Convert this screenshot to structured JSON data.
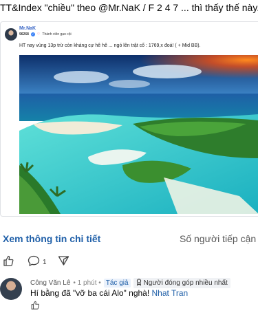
{
  "post": {
    "header_text": "TT&Index \"chiều\" theo @Mr.NaK / F 2 4 7 ... thì thấy thế này.",
    "author": "Mr.NaK",
    "user_id": "96268",
    "badge": "Thành viên gạo cội",
    "body": "HT nay vùng 13p trừ còn kháng cự hê hê ... ngó lên trật cổ : 1769,x đoá! ( + Mid BB).",
    "image_alt": "tropical island lagoon",
    "more_link": "Xem thông tin chi tiết",
    "reach_label": "Số người tiếp cận b"
  },
  "actions": {
    "like_icon": "thumbs-up-icon",
    "comment_icon": "comment-bubble-icon",
    "comment_count": "1",
    "share_icon": "share-arrow-icon"
  },
  "comment": {
    "author": "Công Văn Lê",
    "time": "• 1 phút •",
    "author_tag": "Tác giả",
    "contributor_tag": "Người đóng góp nhiều nhất",
    "text_before": "Hí bằng đã \"vỡ ba cái Alo\" nghà!",
    "mention": "Nhat Tran"
  },
  "colors": {
    "link": "#1f5fa8",
    "author_name": "#3b67c6",
    "border": "#dfe1e5"
  }
}
